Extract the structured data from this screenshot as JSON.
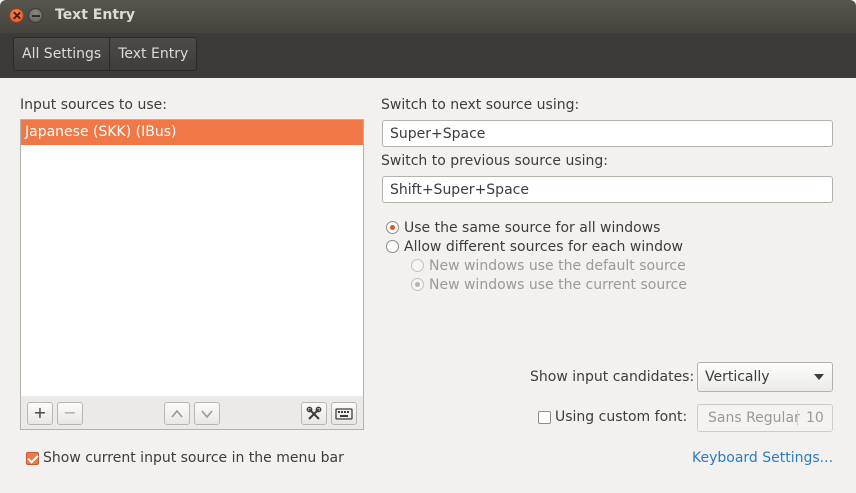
{
  "window": {
    "title": "Text Entry"
  },
  "breadcrumbs": [
    "All Settings",
    "Text Entry"
  ],
  "input_sources": {
    "label": "Input sources to use:",
    "items": [
      "Japanese (SKK) (IBus)"
    ],
    "selected_index": 0
  },
  "list_toolbar": {
    "add_icon": "+",
    "remove_icon": "−",
    "up_icon": "chevron-up-icon",
    "down_icon": "chevron-down-icon",
    "preferences_icon": "tools-icon",
    "keyboard_icon": "keyboard-icon"
  },
  "switch_next": {
    "label": "Switch to next source using:",
    "value": "Super+Space"
  },
  "switch_prev": {
    "label": "Switch to previous source using:",
    "value": "Shift+Super+Space"
  },
  "source_mode": {
    "same_label": "Use the same source for all windows",
    "different_label": "Allow different sources for each window",
    "selected": "same"
  },
  "new_windows": {
    "default_label": "New windows use the default source",
    "current_label": "New windows use the current source",
    "selected": "current",
    "enabled": false
  },
  "candidates": {
    "label": "Show input candidates:",
    "value": "Vertically"
  },
  "custom_font": {
    "label": "Using custom font:",
    "checked": false,
    "font_name": "Sans Regular",
    "font_size": "10"
  },
  "show_in_menubar": {
    "label": "Show current input source in the menu bar",
    "checked": true
  },
  "keyboard_settings_link": "Keyboard Settings...",
  "colors": {
    "accent": "#f07746",
    "titlebar": "#45433d",
    "link": "#2b7bbf"
  }
}
